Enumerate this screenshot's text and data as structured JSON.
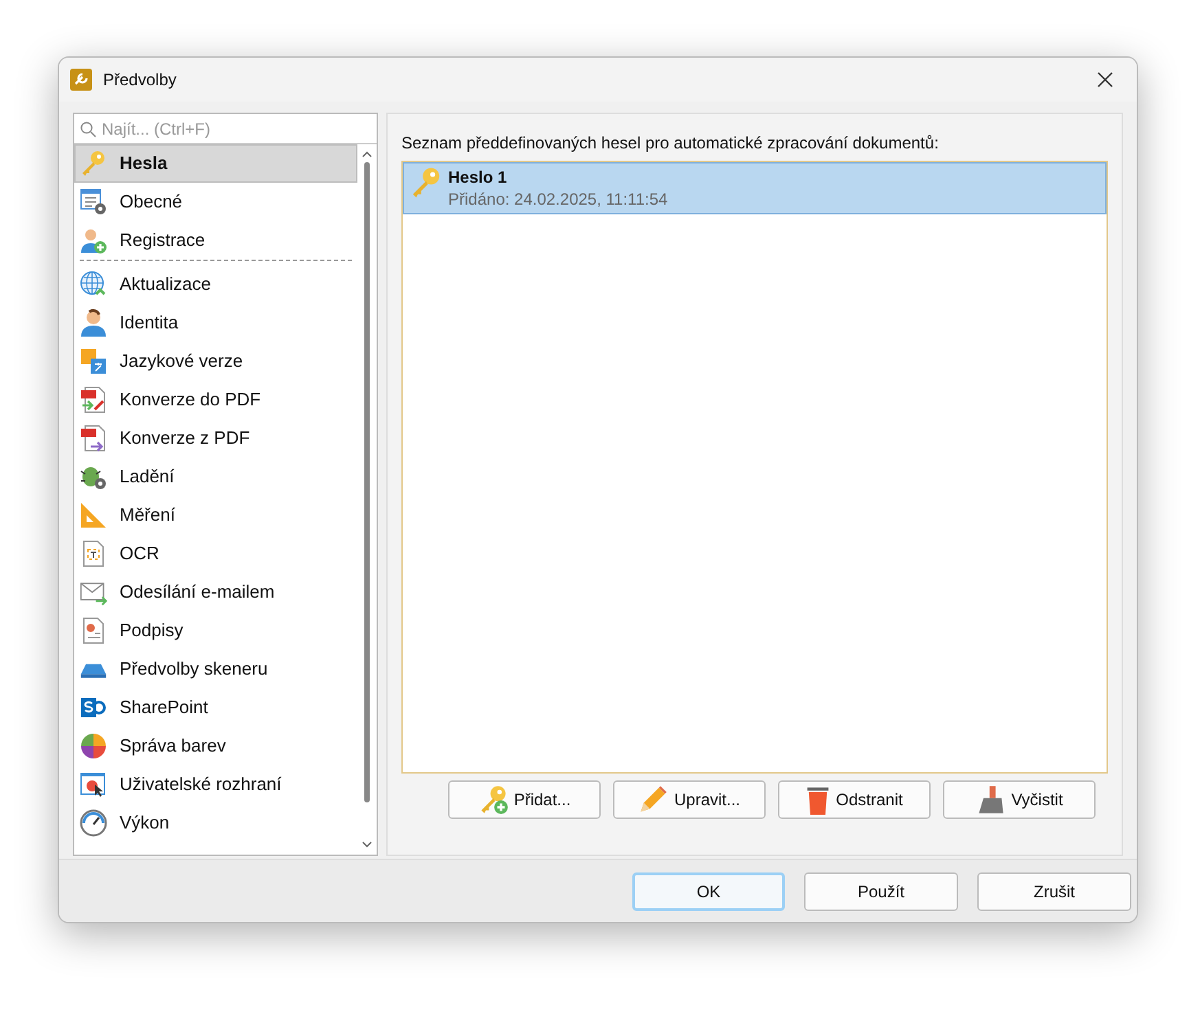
{
  "window": {
    "title": "Předvolby"
  },
  "search": {
    "placeholder": "Najít... (Ctrl+F)"
  },
  "sidebar": {
    "groups": [
      [
        {
          "label": "Hesla",
          "selected": true
        },
        {
          "label": "Obecné",
          "selected": false
        },
        {
          "label": "Registrace",
          "selected": false
        }
      ],
      [
        {
          "label": "Aktualizace",
          "selected": false
        },
        {
          "label": "Identita",
          "selected": false
        },
        {
          "label": "Jazykové verze",
          "selected": false
        },
        {
          "label": "Konverze do PDF",
          "selected": false
        },
        {
          "label": "Konverze z PDF",
          "selected": false
        },
        {
          "label": "Ladění",
          "selected": false
        },
        {
          "label": "Měření",
          "selected": false
        },
        {
          "label": "OCR",
          "selected": false
        },
        {
          "label": "Odesílání e-mailem",
          "selected": false
        },
        {
          "label": "Podpisy",
          "selected": false
        },
        {
          "label": "Předvolby skeneru",
          "selected": false
        },
        {
          "label": "SharePoint",
          "selected": false
        },
        {
          "label": "Správa barev",
          "selected": false
        },
        {
          "label": "Uživatelské rozhraní",
          "selected": false
        },
        {
          "label": "Výkon",
          "selected": false
        }
      ]
    ]
  },
  "panel": {
    "caption": "Seznam předdefinovaných hesel pro automatické zpracování dokumentů:",
    "passwords": [
      {
        "name": "Heslo 1",
        "added": "Přidáno: 24.02.2025, 11:11:54",
        "selected": true
      }
    ],
    "actions": [
      "Přidat...",
      "Upravit...",
      "Odstranit",
      "Vyčistit"
    ]
  },
  "buttons": [
    {
      "label": "OK",
      "default": true
    },
    {
      "label": "Použít",
      "default": false
    },
    {
      "label": "Zrušit",
      "default": false
    }
  ]
}
